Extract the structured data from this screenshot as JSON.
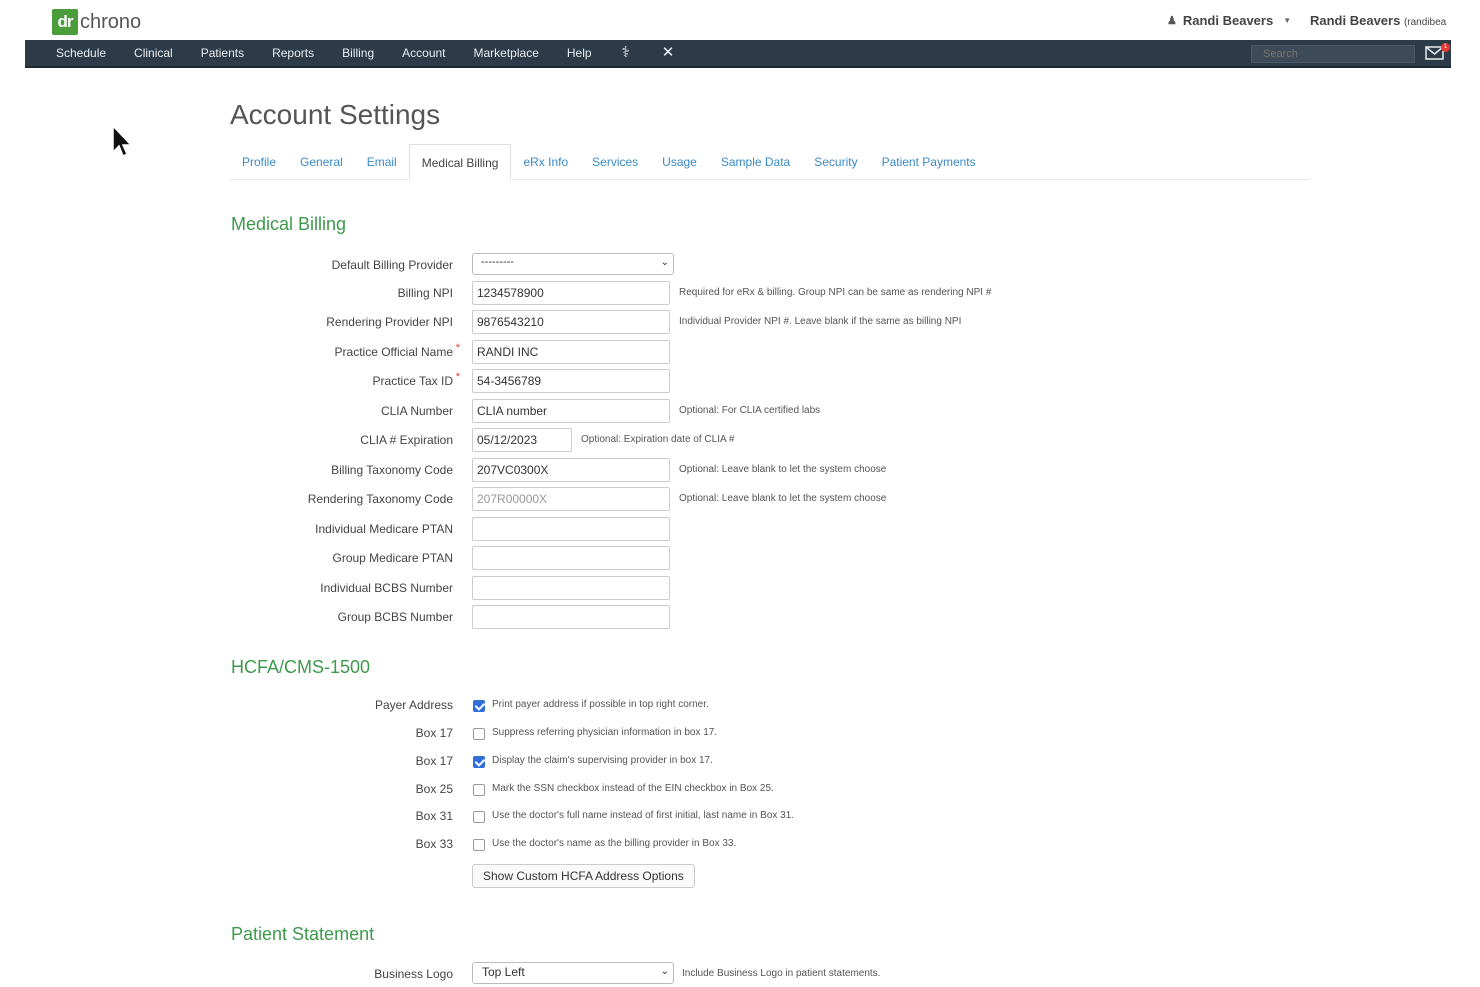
{
  "brand": {
    "logo_mark": "dr",
    "logo_text": "chrono",
    "accent": "#4a9d3a"
  },
  "user": {
    "name": "Randi Beavers",
    "name_right": "Randi Beavers",
    "handle": "(randibea"
  },
  "nav": {
    "items": [
      "Schedule",
      "Clinical",
      "Patients",
      "Reports",
      "Billing",
      "Account",
      "Marketplace",
      "Help"
    ],
    "extra_icons": [
      "caduceus-icon",
      "close-icon"
    ],
    "search_placeholder": "Search",
    "mail_badge": "1"
  },
  "page": {
    "title": "Account Settings",
    "tabs": [
      "Profile",
      "General",
      "Email",
      "Medical Billing",
      "eRx Info",
      "Services",
      "Usage",
      "Sample Data",
      "Security",
      "Patient Payments"
    ],
    "active_tab": "Medical Billing"
  },
  "medical_billing": {
    "title": "Medical Billing",
    "default_billing_provider": {
      "label": "Default Billing Provider",
      "value": "---------"
    },
    "fields": [
      {
        "label": "Billing NPI",
        "value": "1234578900",
        "help": "Required for eRx & billing. Group NPI can be same as rendering NPI #"
      },
      {
        "label": "Rendering Provider NPI",
        "value": "9876543210",
        "help": "Individual Provider NPI #. Leave blank if the same as billing NPI"
      },
      {
        "label": "Practice Official Name",
        "value": "RANDI INC",
        "help": "",
        "required": "*"
      },
      {
        "label": "Practice Tax ID",
        "value": "54-3456789",
        "help": "",
        "required": "*"
      },
      {
        "label": "CLIA Number",
        "value": "CLIA number",
        "help": "Optional: For CLIA certified labs"
      },
      {
        "label": "CLIA # Expiration",
        "value": "05/12/2023",
        "help": "Optional: Expiration date of CLIA #"
      },
      {
        "label": "Billing Taxonomy Code",
        "value": "207VC0300X",
        "help": "Optional: Leave blank to let the system choose"
      },
      {
        "label": "Rendering Taxonomy Code",
        "value": "207R00000X",
        "help": "Optional: Leave blank to let the system choose"
      },
      {
        "label": "Individual Medicare PTAN",
        "value": "",
        "help": ""
      },
      {
        "label": "Group Medicare PTAN",
        "value": "",
        "help": ""
      },
      {
        "label": "Individual BCBS Number",
        "value": "",
        "help": ""
      },
      {
        "label": "Group BCBS Number",
        "value": "",
        "help": ""
      }
    ]
  },
  "hcfa": {
    "title": "HCFA/CMS-1500",
    "options": [
      {
        "label": "Payer Address",
        "text": "Print payer address if possible in top right corner.",
        "checked": true
      },
      {
        "label": "Box 17",
        "text": "Suppress referring physician information in box 17.",
        "checked": false
      },
      {
        "label": "Box 17",
        "text": "Display the claim's supervising provider in box 17.",
        "checked": true
      },
      {
        "label": "Box 25",
        "text": "Mark the SSN checkbox instead of the EIN checkbox in Box 25.",
        "checked": false
      },
      {
        "label": "Box 31",
        "text": "Use the doctor's full name instead of first initial, last name in Box 31.",
        "checked": false
      },
      {
        "label": "Box 33",
        "text": "Use the doctor's name as the billing provider in Box 33.",
        "checked": false
      }
    ],
    "custom_button": "Show Custom HCFA Address Options"
  },
  "patient_statement": {
    "title": "Patient Statement",
    "business_logo": {
      "label": "Business Logo",
      "value": "Top Left",
      "help": "Include Business Logo in patient statements."
    }
  }
}
